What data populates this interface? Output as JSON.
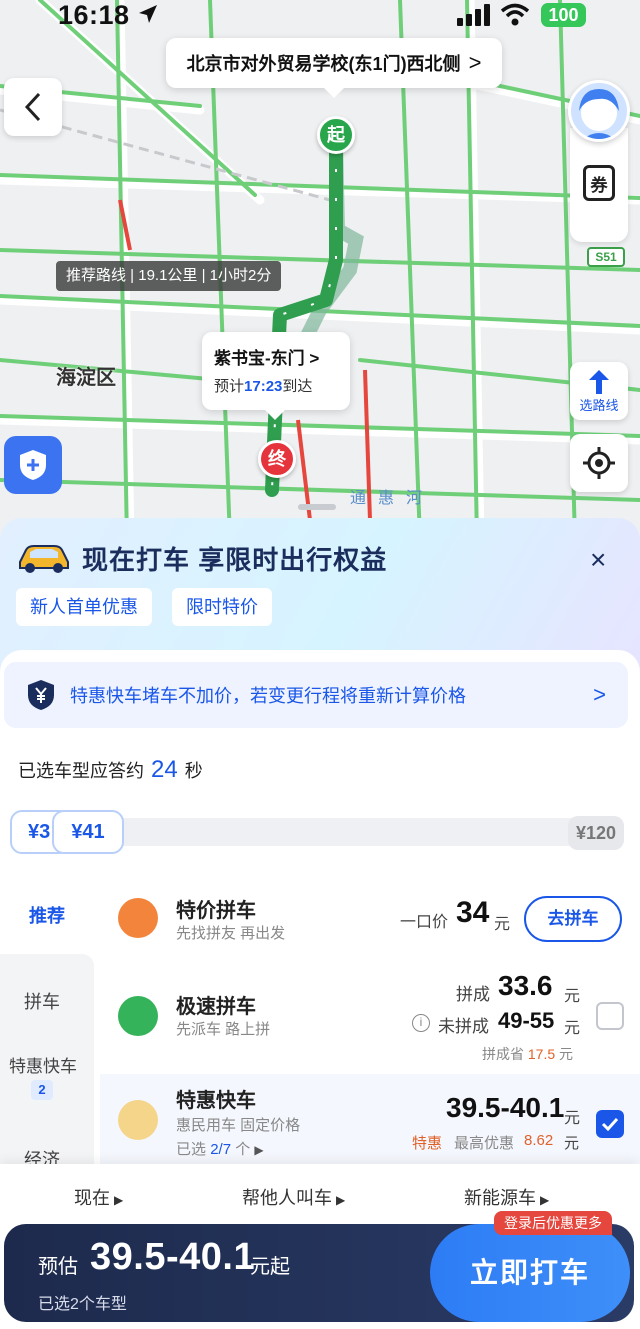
{
  "status_bar": {
    "time": "16:18",
    "battery": "100"
  },
  "map": {
    "origin_label": "北京市对外贸易学校(东1门)西北侧",
    "origin_chevron": ">",
    "district_label": "海淀区",
    "highway_badge": "S51",
    "river_label": "通惠河",
    "route_summary": "推荐路线 | 19.1公里 | 1小时2分",
    "start_pin": "起",
    "end_pin": "终",
    "destination": {
      "name": "紫书宝-东门",
      "chevron": ">",
      "eta_prefix": "预计",
      "eta_time": "17:23",
      "eta_suffix": "到达"
    },
    "coupon_icon_text": "券",
    "route_select_label": "选路线"
  },
  "promo": {
    "title": "现在打车 享限时出行权益",
    "close": "×",
    "tags": [
      "新人首单优惠",
      "限时特价"
    ]
  },
  "notice": {
    "text": "特惠快车堵车不加价，若变更行程将重新计算价格",
    "chevron": ">"
  },
  "wait_time": {
    "prefix": "已选车型应答约",
    "seconds": "24",
    "suffix": "秒"
  },
  "price_slider": {
    "min_chip": "¥3",
    "current_chip": "¥41",
    "max_chip": "¥120"
  },
  "left_nav": {
    "items": [
      {
        "label": "推荐",
        "active": true
      },
      {
        "label": "拼车"
      },
      {
        "label": "特惠快车",
        "badge": "2"
      },
      {
        "label": "经济"
      }
    ]
  },
  "rides": [
    {
      "name": "特价拼车",
      "sub": "先找拼友 再出发",
      "price_prefix": "一口价",
      "price": "34",
      "unit": "元",
      "action": "去拼车"
    },
    {
      "name": "极速拼车",
      "sub": "先派车 路上拼",
      "pooled_label": "拼成",
      "pooled_price": "33.6",
      "unit": "元",
      "unpooled_label": "未拼成",
      "unpooled_price": "49-55",
      "save_label": "拼成省",
      "save_amount": "17.5",
      "save_unit": "元",
      "checked": false
    },
    {
      "name": "特惠快车",
      "sub": "惠民用车 固定价格",
      "selected_prefix": "已选",
      "selected_count": "2/7",
      "selected_suffix": "个",
      "price": "39.5-40.1",
      "unit": "元",
      "promo_label": "特惠",
      "discount_label": "最高优惠",
      "discount_amount": "8.62",
      "checked": true
    }
  ],
  "options": [
    "现在",
    "帮他人叫车",
    "新能源车"
  ],
  "login_tag": "登录后优惠更多",
  "estimate": {
    "prefix": "预估",
    "price": "39.5-40.1",
    "unit": "元起",
    "selected": "已选2个车型"
  },
  "call_button": "立即打车",
  "colors": {
    "accent": "#1a57e8",
    "route_green": "#29a64b",
    "end_red": "#e5343c",
    "promo_orange": "#e0622a"
  }
}
